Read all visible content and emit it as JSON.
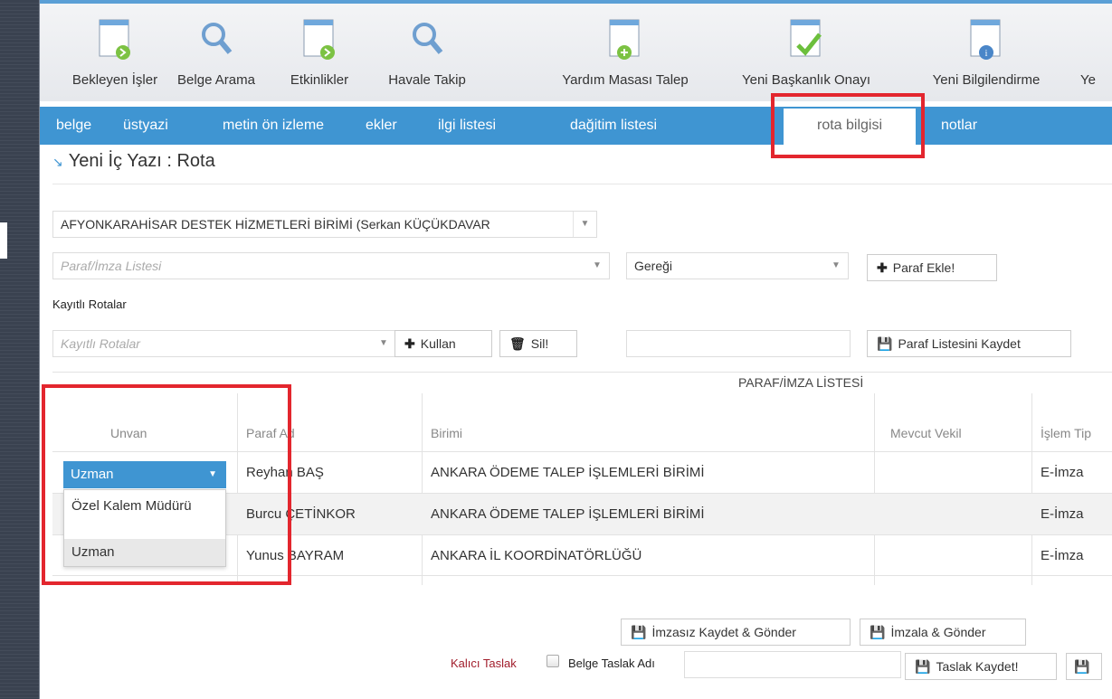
{
  "toolbar": {
    "items": [
      {
        "label": "Bekleyen İşler",
        "icon": "document-arrow-icon"
      },
      {
        "label": "Belge Arama",
        "icon": "search-icon"
      },
      {
        "label": "Etkinlikler",
        "icon": "document-arrow-icon"
      },
      {
        "label": "Havale Takip",
        "icon": "search-icon"
      },
      {
        "label": "Yardım Masası Talep",
        "icon": "document-plus-icon"
      },
      {
        "label": "Yeni Başkanlık Onayı",
        "icon": "document-check-icon"
      },
      {
        "label": "Yeni Bilgilendirme",
        "icon": "document-info-icon"
      },
      {
        "label": "Ye",
        "icon": ""
      }
    ]
  },
  "nav": {
    "tabs": [
      "belge",
      "üstyazi",
      "metin ön izleme",
      "ekler",
      "ilgi listesi",
      "dağitim listesi",
      "rota bilgisi",
      "notlar"
    ],
    "active": "rota bilgisi"
  },
  "page": {
    "title": "Yeni İç Yazı : Rota"
  },
  "form": {
    "unit_select": "AFYONKARAHİSAR DESTEK HİZMETLERİ BİRİMİ (Serkan KÜÇÜKDAVAR",
    "paraf_placeholder": "Paraf/İmza Listesi",
    "geregi_select": "Gereği",
    "paraf_ekle": "Paraf Ekle!",
    "kayitli_label": "Kayıtlı Rotalar",
    "kayitli_placeholder": "Kayıtlı Rotalar",
    "kullan": "Kullan",
    "sil": "Sil!",
    "paraf_kaydet": "Paraf Listesini Kaydet"
  },
  "table": {
    "caption": "PARAF/İMZA LİSTESİ",
    "headers": {
      "unvan": "Unvan",
      "paraf_ad": "Paraf Ad",
      "birimi": "Birimi",
      "vekil": "Mevcut Vekil",
      "islem": "İşlem Tip"
    },
    "rows": [
      {
        "ad": "Reyhan BAŞ",
        "birim": "ANKARA ÖDEME TALEP İŞLEMLERİ BİRİMİ",
        "islem": "E-İmza"
      },
      {
        "ad": "Burcu ÇETİNKOR",
        "birim": "ANKARA ÖDEME TALEP İŞLEMLERİ BİRİMİ",
        "islem": "E-İmza"
      },
      {
        "ad": "Yunus BAYRAM",
        "birim": "ANKARA İL KOORDİNATÖRLÜĞÜ",
        "islem": "E-İmza"
      }
    ]
  },
  "unvan_dropdown": {
    "selected": "Uzman",
    "options": [
      "Özel Kalem Müdürü",
      "Uzman"
    ]
  },
  "footer": {
    "imzasiz": "İmzasız Kaydet & Gönder",
    "imzala": "İmzala & Gönder",
    "kalici": "Kalıcı Taslak",
    "taslak_adi": "Belge Taslak Adı",
    "taslak_kaydet": "Taslak Kaydet!"
  },
  "colors": {
    "accent": "#3f95d2",
    "highlight": "#e3262e"
  }
}
